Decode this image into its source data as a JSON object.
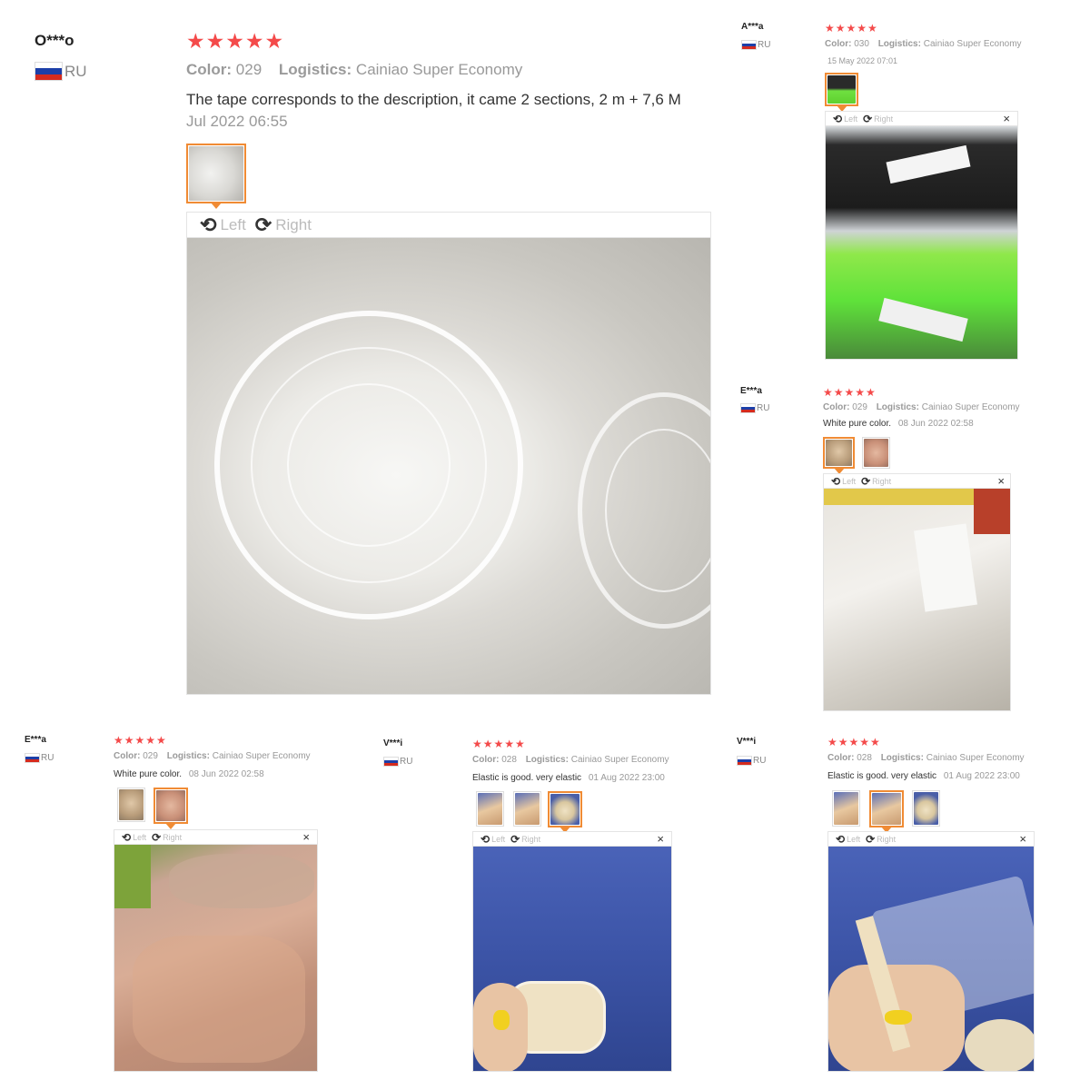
{
  "arrow_glyphs": {
    "left": "⟲",
    "right": "⟳",
    "close": "×"
  },
  "colors": {
    "stars": "#f44a4a",
    "active_thumb": "#f08b34"
  },
  "reviews": [
    {
      "user": "O***o",
      "country": "RU",
      "stars": "★★★★★",
      "color_label": "Color:",
      "color_value": "029",
      "logistics_label": "Logistics:",
      "logistics_value": "Cainiao Super Economy",
      "text": "The tape corresponds to the description, it came 2 sections, 2 m + 7,6 M",
      "date": "Jul 2022 06:55",
      "viewer": {
        "left": "Left",
        "right": "Right"
      }
    },
    {
      "user": "A***a",
      "country": "RU",
      "stars": "★★★★★",
      "color_label": "Color:",
      "color_value": "030",
      "logistics_label": "Logistics:",
      "logistics_value": "Cainiao Super Economy",
      "date": "15 May 2022 07:01",
      "viewer": {
        "left": "Left",
        "right": "Right"
      }
    },
    {
      "user": "E***a",
      "country": "RU",
      "stars": "★★★★★",
      "color_label": "Color:",
      "color_value": "029",
      "logistics_label": "Logistics:",
      "logistics_value": "Cainiao Super Economy",
      "text": "White pure color.",
      "date": "08 Jun 2022 02:58",
      "viewer": {
        "left": "Left",
        "right": "Right"
      }
    },
    {
      "user": "E***a",
      "country": "RU",
      "stars": "★★★★★",
      "color_label": "Color:",
      "color_value": "029",
      "logistics_label": "Logistics:",
      "logistics_value": "Cainiao Super Economy",
      "text": "White pure color.",
      "date": "08 Jun 2022 02:58",
      "viewer": {
        "left": "Left",
        "right": "Right"
      }
    },
    {
      "user": "V***i",
      "country": "RU",
      "stars": "★★★★★",
      "color_label": "Color:",
      "color_value": "028",
      "logistics_label": "Logistics:",
      "logistics_value": "Cainiao Super Economy",
      "text": "Elastic is good. very elastic",
      "date": "01 Aug 2022 23:00",
      "viewer": {
        "left": "Left",
        "right": "Right"
      }
    },
    {
      "user": "V***i",
      "country": "RU",
      "stars": "★★★★★",
      "color_label": "Color:",
      "color_value": "028",
      "logistics_label": "Logistics:",
      "logistics_value": "Cainiao Super Economy",
      "text": "Elastic is good. very elastic",
      "date": "01 Aug 2022 23:00",
      "viewer": {
        "left": "Left",
        "right": "Right"
      }
    }
  ]
}
